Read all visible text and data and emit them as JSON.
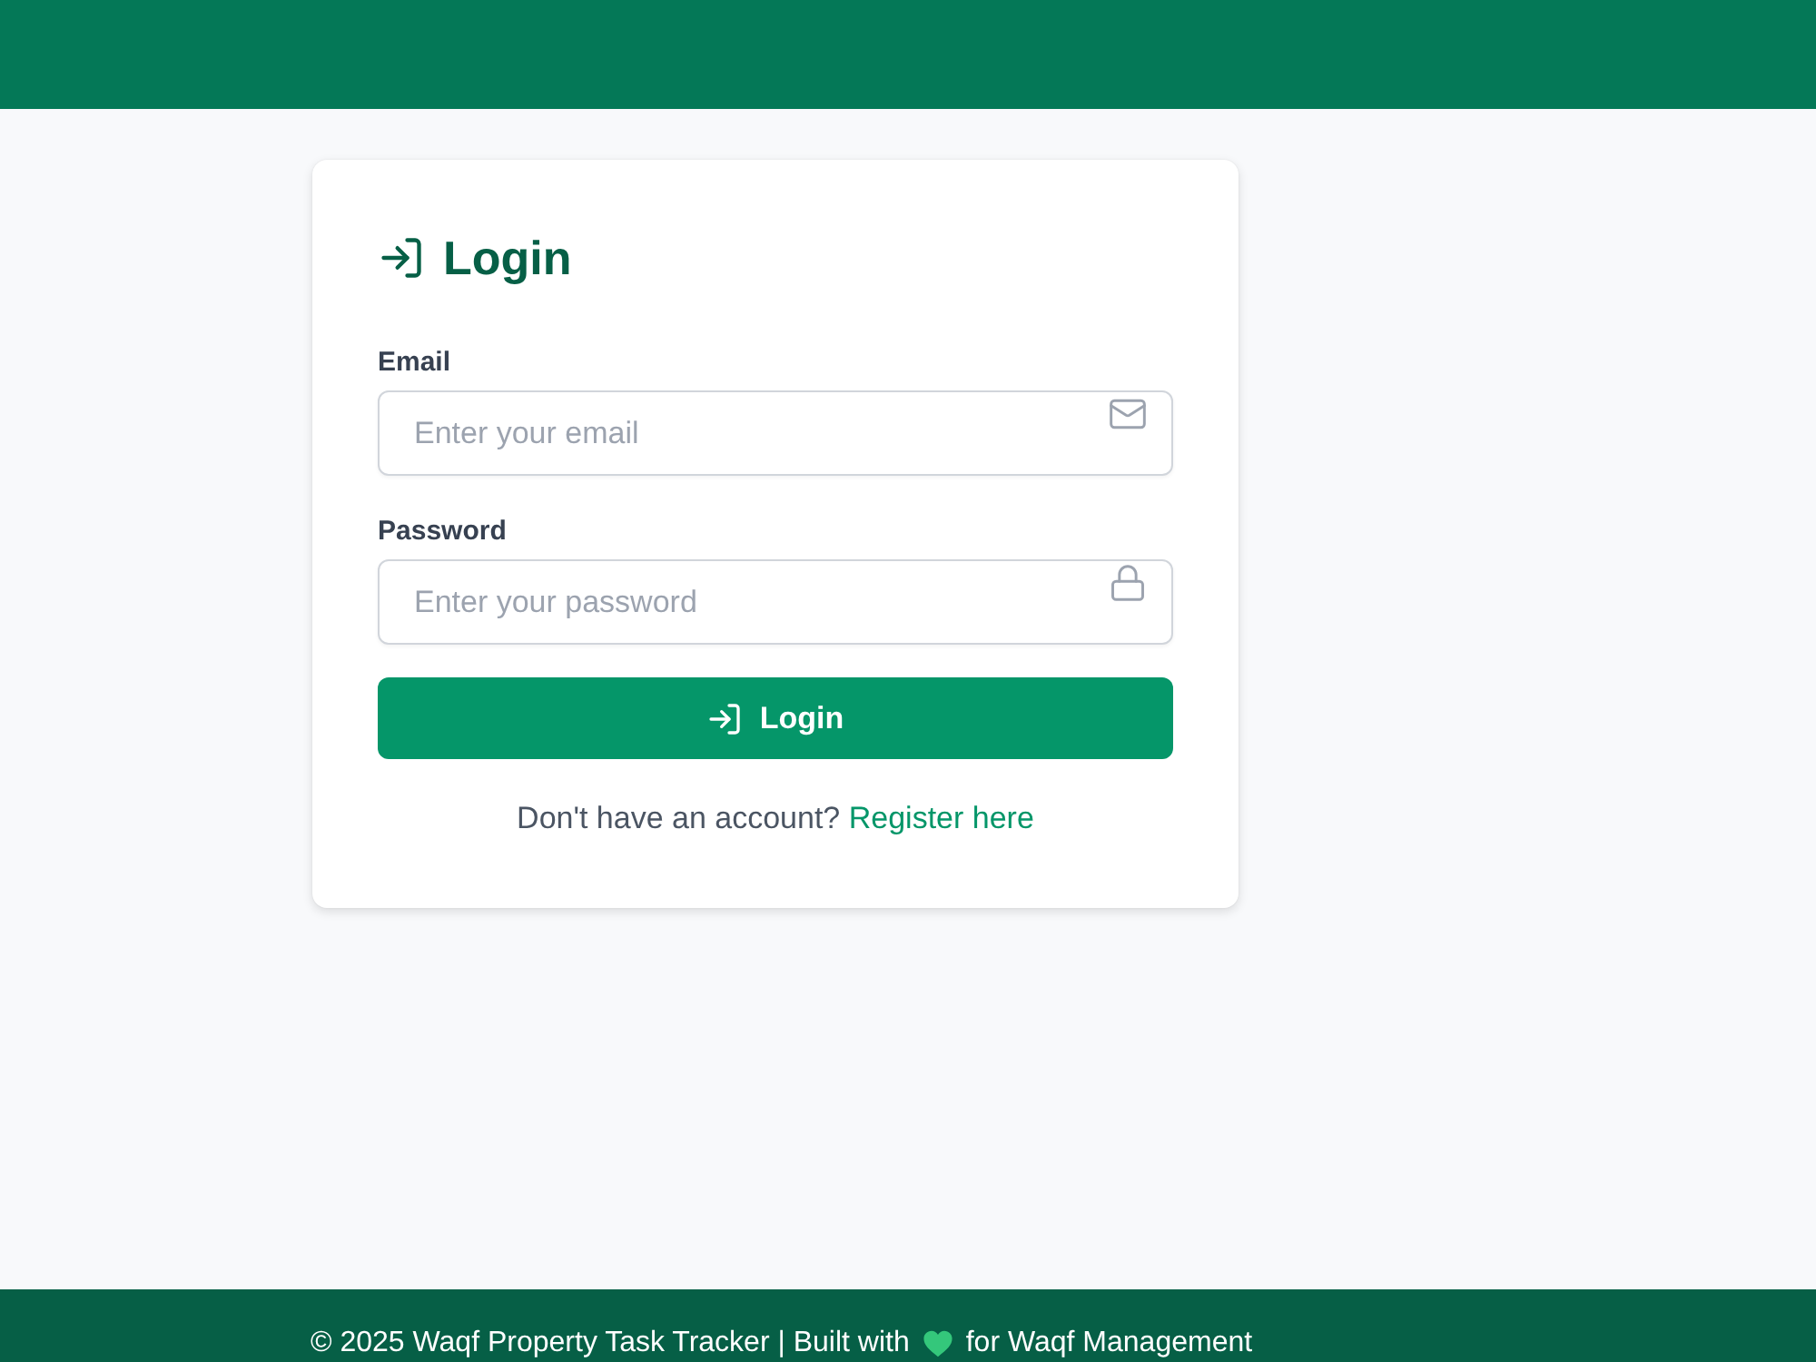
{
  "card": {
    "title": "Login",
    "fields": [
      {
        "kind": "email",
        "label": "Email",
        "placeholder": "Enter your email"
      },
      {
        "kind": "password",
        "label": "Password",
        "placeholder": "Enter your password"
      }
    ],
    "submit_button": {
      "label": "Login"
    },
    "register_prompt": {
      "text": "Don't have an account?",
      "link": "Register here"
    }
  },
  "footer": {
    "text_before": "© 2025 Waqf Property Task Tracker | Built with",
    "text_after": "for Waqf Management"
  }
}
